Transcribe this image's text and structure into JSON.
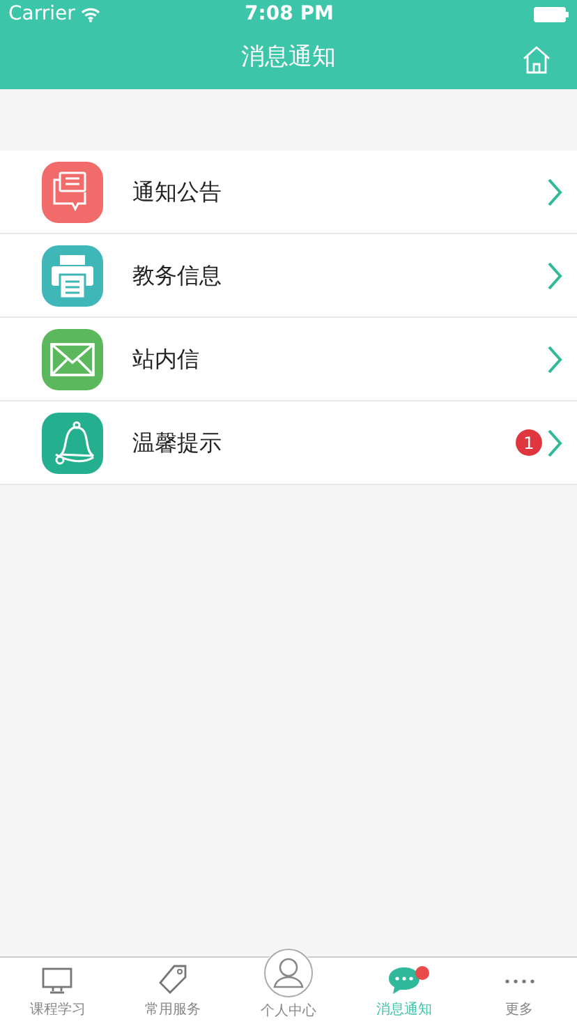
{
  "status_bar": {
    "carrier": "Carrier",
    "time": "7:08 PM"
  },
  "nav": {
    "title": "消息通知"
  },
  "items": [
    {
      "kind": "notice",
      "label": "通知公告"
    },
    {
      "kind": "printer",
      "label": "教务信息"
    },
    {
      "kind": "mail",
      "label": "站内信"
    },
    {
      "kind": "bell",
      "label": "温馨提示",
      "badge": "1"
    }
  ],
  "tabs": [
    {
      "kind": "monitor",
      "label": "课程学习",
      "selected": false,
      "dot": false
    },
    {
      "kind": "tag",
      "label": "常用服务",
      "selected": false,
      "dot": false
    },
    {
      "kind": "person",
      "label": "个人中心",
      "selected": false,
      "dot": false
    },
    {
      "kind": "chat",
      "label": "消息通知",
      "selected": true,
      "dot": true
    },
    {
      "kind": "more",
      "label": "更多",
      "selected": false,
      "dot": false
    }
  ]
}
